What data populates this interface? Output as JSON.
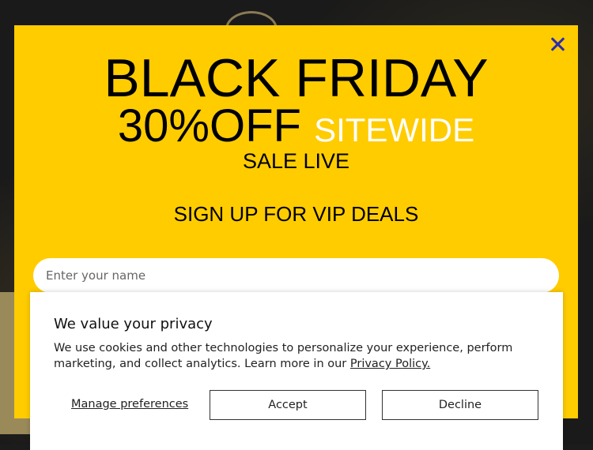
{
  "popup": {
    "headline": "BLACK FRIDAY",
    "discount": "30%OFF",
    "sitewide": "SITEWIDE",
    "sale": "SALE LIVE",
    "signup": "SIGN UP FOR VIP DEALS",
    "name_placeholder": "Enter your name"
  },
  "privacy": {
    "title": "We value your privacy",
    "message": "We use cookies and other technologies to personalize your experience, perform marketing, and collect analytics. Learn more in our ",
    "policy_link": "Privacy Policy.",
    "manage_label": "Manage preferences",
    "accept_label": "Accept",
    "decline_label": "Decline"
  },
  "colors": {
    "popup_bg": "#ffcc00",
    "close_icon": "#2b2bb0"
  },
  "icons": {
    "close": "close-icon"
  }
}
